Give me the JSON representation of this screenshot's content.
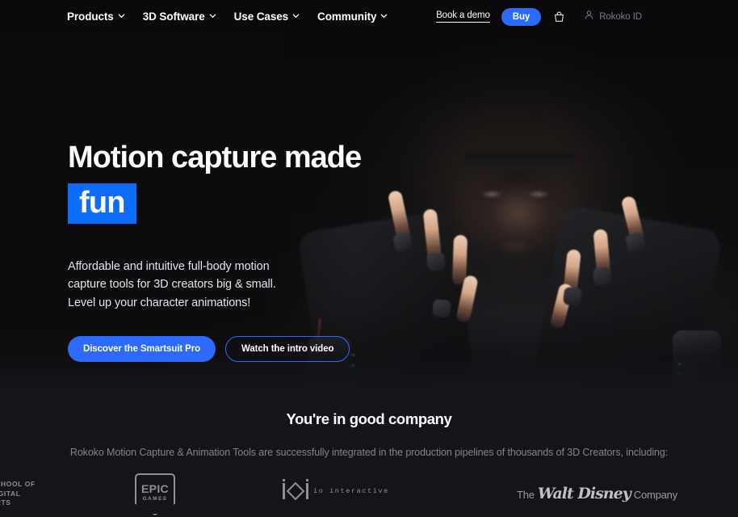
{
  "nav": {
    "menu": [
      {
        "label": "Products",
        "icon": "chevron-down-icon"
      },
      {
        "label": "3D Software",
        "icon": "chevron-down-icon"
      },
      {
        "label": "Use Cases",
        "icon": "chevron-down-icon"
      },
      {
        "label": "Community",
        "icon": "chevron-down-icon"
      }
    ],
    "book_demo_label": "Book a demo",
    "buy_label": "Buy",
    "cart_icon": "shopping-bag-icon",
    "account_icon": "user-icon",
    "account_label": "Rokoko ID"
  },
  "hero": {
    "title_line1": "Motion capture made",
    "title_highlight": "fun",
    "subtitle_line1": "Affordable and intuitive full-body motion",
    "subtitle_line2": "capture tools for 3D creators big & small.",
    "subtitle_line3": "Level up your character animations!",
    "primary_cta": "Discover the Smartsuit Pro",
    "secondary_cta": "Watch the intro video",
    "image_alt": "Person wearing Rokoko motion capture gloves with hands raised"
  },
  "company": {
    "title": "You're in good company",
    "subtitle": "Rokoko Motion Capture & Animation Tools are successfully integrated in the production pipelines of thousands of 3D Creators, including:",
    "logos": [
      {
        "name": "school-of-digital-arts",
        "line1": "SCHOOL OF",
        "line2": "DIGITAL",
        "line3": "ARTS"
      },
      {
        "name": "epic-games",
        "word": "EPIC",
        "sub": "GAMES"
      },
      {
        "name": "io-interactive",
        "text": "io interactive"
      },
      {
        "name": "walt-disney-company",
        "the": "The",
        "script": "Walt Disney",
        "company": "Company"
      }
    ]
  },
  "colors": {
    "accent_blue": "#2c6aff",
    "highlight_blue": "#0d6bfd",
    "nav_bg": "#0a0a0c",
    "section_bg": "#141519",
    "muted_text": "#83858d"
  }
}
